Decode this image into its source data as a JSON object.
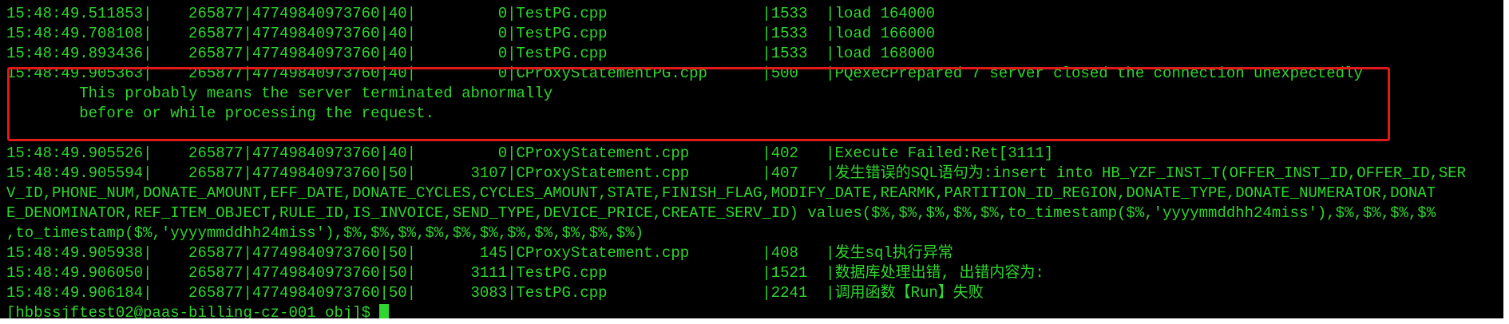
{
  "terminal": {
    "lines": [
      "15:48:49.511853|    265877|47749840973760|40|         0|TestPG.cpp                 |1533  |load 164000",
      "15:48:49.708108|    265877|47749840973760|40|         0|TestPG.cpp                 |1533  |load 166000",
      "15:48:49.893436|    265877|47749840973760|40|         0|TestPG.cpp                 |1533  |load 168000",
      "15:48:49.905363|    265877|47749840973760|40|         0|CProxyStatementPG.cpp      |500   |PQexecPrepared 7 server closed the connection unexpectedly",
      "        This probably means the server terminated abnormally",
      "        before or while processing the request.",
      "",
      "15:48:49.905526|    265877|47749840973760|40|         0|CProxyStatement.cpp        |402   |Execute Failed:Ret[3111]",
      "15:48:49.905594|    265877|47749840973760|50|      3107|CProxyStatement.cpp        |407   |发生错误的SQL语句为:insert into HB_YZF_INST_T(OFFER_INST_ID,OFFER_ID,SER",
      "V_ID,PHONE_NUM,DONATE_AMOUNT,EFF_DATE,DONATE_CYCLES,CYCLES_AMOUNT,STATE,FINISH_FLAG,MODIFY_DATE,REARMK,PARTITION_ID_REGION,DONATE_TYPE,DONATE_NUMERATOR,DONAT",
      "E_DENOMINATOR,REF_ITEM_OBJECT,RULE_ID,IS_INVOICE,SEND_TYPE,DEVICE_PRICE,CREATE_SERV_ID) values($%,$%,$%,$%,$%,to_timestamp($%,'yyyymmddhh24miss'),$%,$%,$%,$%",
      ",to_timestamp($%,'yyyymmddhh24miss'),$%,$%,$%,$%,$%,$%,$%,$%,$%,$%,$%)",
      "15:48:49.905938|    265877|47749840973760|50|       145|CProxyStatement.cpp        |408   |发生sql执行异常",
      "15:48:49.906050|    265877|47749840973760|50|      3111|TestPG.cpp                 |1521  |数据库处理出错, 出错内容为:",
      "15:48:49.906184|    265877|47749840973760|50|      3083|TestPG.cpp                 |2241  |调用函数【Run】失败"
    ],
    "prompt": "[hbbssjftest02@paas-billing-cz-001 obj]$ "
  },
  "colors": {
    "background": "#000000",
    "text": "#2fd62f",
    "highlight_border": "#e11919"
  }
}
